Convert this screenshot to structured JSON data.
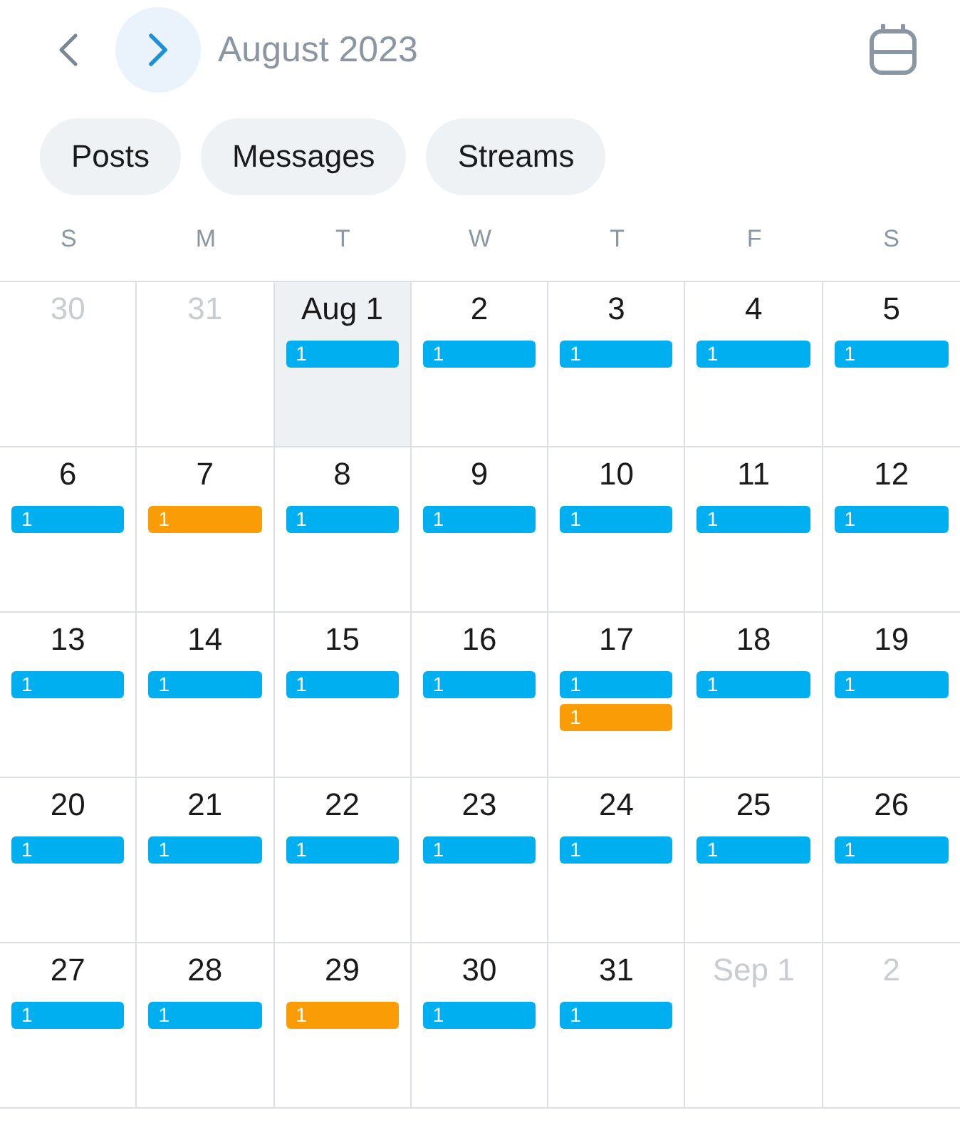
{
  "header": {
    "title": "August 2023"
  },
  "filters": [
    {
      "label": "Posts",
      "selected": false
    },
    {
      "label": "Messages",
      "selected": false
    },
    {
      "label": "Streams",
      "selected": false
    }
  ],
  "weekdays": [
    "S",
    "M",
    "T",
    "W",
    "T",
    "F",
    "S"
  ],
  "weeks": [
    {
      "days": [
        {
          "label": "30",
          "outside": true,
          "selected": false
        },
        {
          "label": "31",
          "outside": true,
          "selected": false
        },
        {
          "label": "Aug 1",
          "outside": false,
          "selected": true,
          "events": [
            {
              "label": "1",
              "color": "#00aff0"
            }
          ]
        },
        {
          "label": "2",
          "outside": false,
          "selected": false,
          "events": [
            {
              "label": "1",
              "color": "#00aff0"
            }
          ]
        },
        {
          "label": "3",
          "outside": false,
          "selected": false,
          "events": [
            {
              "label": "1",
              "color": "#00aff0"
            }
          ]
        },
        {
          "label": "4",
          "outside": false,
          "selected": false,
          "events": [
            {
              "label": "1",
              "color": "#00aff0"
            }
          ]
        },
        {
          "label": "5",
          "outside": false,
          "selected": false,
          "events": [
            {
              "label": "1",
              "color": "#00aff0"
            }
          ]
        }
      ]
    },
    {
      "days": [
        {
          "label": "6",
          "outside": false,
          "selected": false,
          "events": [
            {
              "label": "1",
              "color": "#00aff0"
            }
          ]
        },
        {
          "label": "7",
          "outside": false,
          "selected": false,
          "events": [
            {
              "label": "1",
              "color": "#fa9c05"
            }
          ]
        },
        {
          "label": "8",
          "outside": false,
          "selected": false,
          "events": [
            {
              "label": "1",
              "color": "#00aff0"
            }
          ]
        },
        {
          "label": "9",
          "outside": false,
          "selected": false,
          "events": [
            {
              "label": "1",
              "color": "#00aff0"
            }
          ]
        },
        {
          "label": "10",
          "outside": false,
          "selected": false,
          "events": [
            {
              "label": "1",
              "color": "#00aff0"
            }
          ]
        },
        {
          "label": "11",
          "outside": false,
          "selected": false,
          "events": [
            {
              "label": "1",
              "color": "#00aff0"
            }
          ]
        },
        {
          "label": "12",
          "outside": false,
          "selected": false,
          "events": [
            {
              "label": "1",
              "color": "#00aff0"
            }
          ]
        }
      ]
    },
    {
      "days": [
        {
          "label": "13",
          "outside": false,
          "selected": false,
          "events": [
            {
              "label": "1",
              "color": "#00aff0"
            }
          ]
        },
        {
          "label": "14",
          "outside": false,
          "selected": false,
          "events": [
            {
              "label": "1",
              "color": "#00aff0"
            }
          ]
        },
        {
          "label": "15",
          "outside": false,
          "selected": false,
          "events": [
            {
              "label": "1",
              "color": "#00aff0"
            }
          ]
        },
        {
          "label": "16",
          "outside": false,
          "selected": false,
          "events": [
            {
              "label": "1",
              "color": "#00aff0"
            }
          ]
        },
        {
          "label": "17",
          "outside": false,
          "selected": false,
          "events": [
            {
              "label": "1",
              "color": "#00aff0"
            },
            {
              "label": "1",
              "color": "#fa9c05"
            }
          ]
        },
        {
          "label": "18",
          "outside": false,
          "selected": false,
          "events": [
            {
              "label": "1",
              "color": "#00aff0"
            }
          ]
        },
        {
          "label": "19",
          "outside": false,
          "selected": false,
          "events": [
            {
              "label": "1",
              "color": "#00aff0"
            }
          ]
        }
      ]
    },
    {
      "days": [
        {
          "label": "20",
          "outside": false,
          "selected": false,
          "events": [
            {
              "label": "1",
              "color": "#00aff0"
            }
          ]
        },
        {
          "label": "21",
          "outside": false,
          "selected": false,
          "events": [
            {
              "label": "1",
              "color": "#00aff0"
            }
          ]
        },
        {
          "label": "22",
          "outside": false,
          "selected": false,
          "events": [
            {
              "label": "1",
              "color": "#00aff0"
            }
          ]
        },
        {
          "label": "23",
          "outside": false,
          "selected": false,
          "events": [
            {
              "label": "1",
              "color": "#00aff0"
            }
          ]
        },
        {
          "label": "24",
          "outside": false,
          "selected": false,
          "events": [
            {
              "label": "1",
              "color": "#00aff0"
            }
          ]
        },
        {
          "label": "25",
          "outside": false,
          "selected": false,
          "events": [
            {
              "label": "1",
              "color": "#00aff0"
            }
          ]
        },
        {
          "label": "26",
          "outside": false,
          "selected": false,
          "events": [
            {
              "label": "1",
              "color": "#00aff0"
            }
          ]
        }
      ]
    },
    {
      "days": [
        {
          "label": "27",
          "outside": false,
          "selected": false,
          "events": [
            {
              "label": "1",
              "color": "#00aff0"
            }
          ]
        },
        {
          "label": "28",
          "outside": false,
          "selected": false,
          "events": [
            {
              "label": "1",
              "color": "#00aff0"
            }
          ]
        },
        {
          "label": "29",
          "outside": false,
          "selected": false,
          "events": [
            {
              "label": "1",
              "color": "#fa9c05"
            }
          ]
        },
        {
          "label": "30",
          "outside": false,
          "selected": false,
          "events": [
            {
              "label": "1",
              "color": "#00aff0"
            }
          ]
        },
        {
          "label": "31",
          "outside": false,
          "selected": false,
          "events": [
            {
              "label": "1",
              "color": "#00aff0"
            }
          ]
        },
        {
          "label": "Sep 1",
          "outside": true,
          "selected": false
        },
        {
          "label": "2",
          "outside": true,
          "selected": false
        }
      ]
    }
  ]
}
